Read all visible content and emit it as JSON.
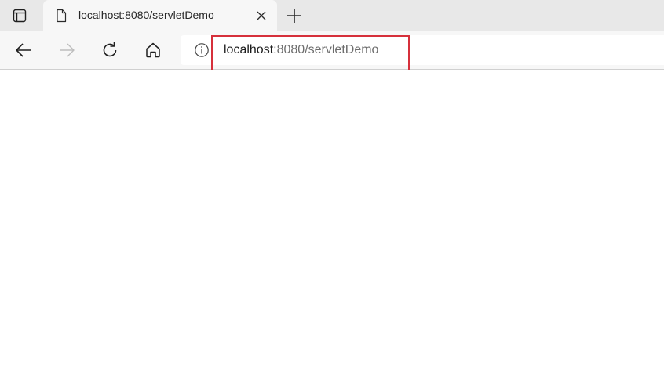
{
  "tab": {
    "title": "localhost:8080/servletDemo"
  },
  "address_bar": {
    "host": "localhost",
    "rest": ":8080/servletDemo"
  },
  "icons": {
    "tab_actions": "tab-actions-icon",
    "favicon": "page-icon",
    "close": "close-icon",
    "new_tab": "plus-icon",
    "back": "back-arrow-icon",
    "forward": "forward-arrow-icon",
    "refresh": "refresh-icon",
    "home": "home-icon",
    "info": "info-icon"
  },
  "colors": {
    "highlight": "#d6303b",
    "tabstrip": "#e8e8e8",
    "toolbar": "#f7f7f7"
  }
}
